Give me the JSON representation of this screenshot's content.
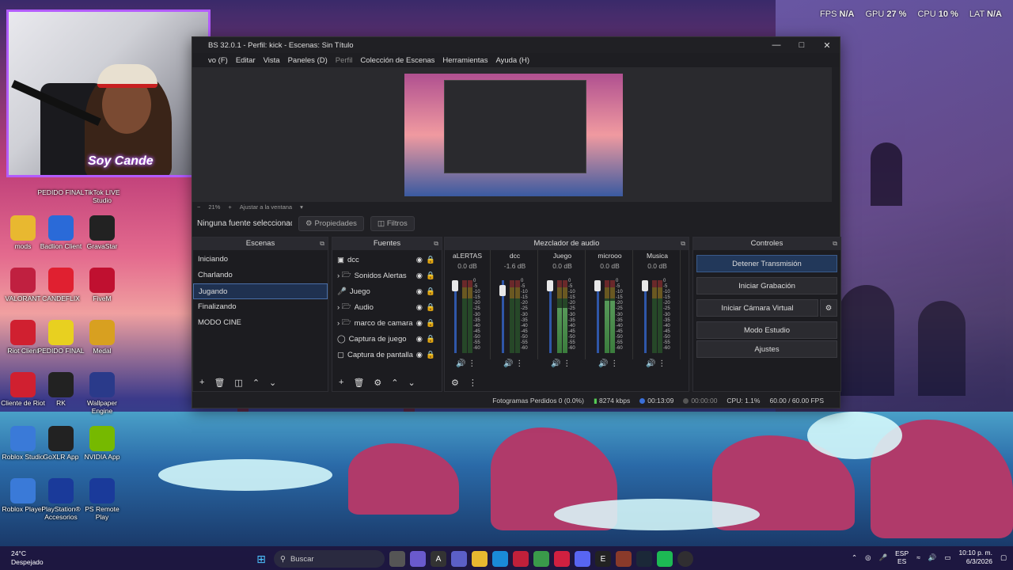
{
  "hud": {
    "fps_label": "FPS",
    "fps_value": "N/A",
    "gpu_label": "GPU",
    "gpu_value": "27 %",
    "cpu_label": "CPU",
    "cpu_value": "10 %",
    "lat_label": "LAT",
    "lat_value": "N/A"
  },
  "webcam": {
    "overlay_text": "Soy Cande"
  },
  "desktop_icons": [
    {
      "label": "PEDIDO FINAL"
    },
    {
      "label": "TikTok LIVE Studio"
    },
    {
      "label": "mods"
    },
    {
      "label": "Badlion Client"
    },
    {
      "label": "GravaStar"
    },
    {
      "label": "VALORANT"
    },
    {
      "label": "CANDEFLIX"
    },
    {
      "label": "FiveM"
    },
    {
      "label": "Riot Client"
    },
    {
      "label": "PEDIDO FINAL"
    },
    {
      "label": "Medal"
    },
    {
      "label": "Cliente de Riot"
    },
    {
      "label": "RK"
    },
    {
      "label": "Wallpaper Engine"
    },
    {
      "label": "Roblox Studio"
    },
    {
      "label": "GoXLR App"
    },
    {
      "label": "NVIDIA App"
    },
    {
      "label": "Roblox Player"
    },
    {
      "label": "PlayStation® Accesorios"
    },
    {
      "label": "PS Remote Play"
    }
  ],
  "obs": {
    "title": "BS 32.0.1 - Perfil: kick - Escenas: Sin Título",
    "menu": [
      "vo (F)",
      "Editar",
      "Vista",
      "Paneles (D)",
      "Perfil",
      "Colección de Escenas",
      "Herramientas",
      "Ayuda (H)"
    ],
    "zoom": "21%",
    "fit_label": "Ajustar a la ventana",
    "no_source": "Ninguna fuente seleccionada",
    "properties_btn": "Propiedades",
    "filters_btn": "Filtros",
    "scenes_title": "Escenas",
    "scenes": [
      "Iniciando",
      "Charlando",
      "Jugando",
      "Finalizando",
      "MODO CINE"
    ],
    "sources_title": "Fuentes",
    "sources": [
      "dcc",
      "Sonidos Alertas",
      "Juego",
      "Audio",
      "marco de camara",
      "Captura de juego",
      "Captura de pantalla"
    ],
    "mixer_title": "Mezclador de audio",
    "mixer": [
      {
        "name": "aLERTAS",
        "db": "0.0 dB",
        "level": 0.0
      },
      {
        "name": "dcc",
        "db": "-1.6 dB",
        "level": 0.0
      },
      {
        "name": "Juego",
        "db": "0.0 dB",
        "level": 0.62
      },
      {
        "name": "microoo",
        "db": "0.0 dB",
        "level": 0.72
      },
      {
        "name": "Musica",
        "db": "0.0 dB",
        "level": 0.0
      }
    ],
    "ticks": [
      "0",
      "-5",
      "-10",
      "-15",
      "-20",
      "-25",
      "-30",
      "-35",
      "-40",
      "-45",
      "-50",
      "-55",
      "-60"
    ],
    "controls_title": "Controles",
    "controls": {
      "stop_stream": "Detener Transmisión",
      "start_record": "Iniciar Grabación",
      "virtual_cam": "Iniciar Cámara Virtual",
      "studio": "Modo Estudio",
      "settings": "Ajustes"
    },
    "status": {
      "dropped": "Fotogramas Perdidos 0 (0.0%)",
      "bitrate": "8274 kbps",
      "stream_time": "00:13:09",
      "rec_time": "00:00:00",
      "cpu": "CPU: 1.1%",
      "fps": "60.00 / 60.00 FPS"
    }
  },
  "taskbar": {
    "temp": "24°C",
    "weather": "Despejado",
    "search_placeholder": "Buscar",
    "lang1": "ESP",
    "lang2": "ES",
    "time": "10:10 p. m.",
    "date": "6/3/2026"
  }
}
